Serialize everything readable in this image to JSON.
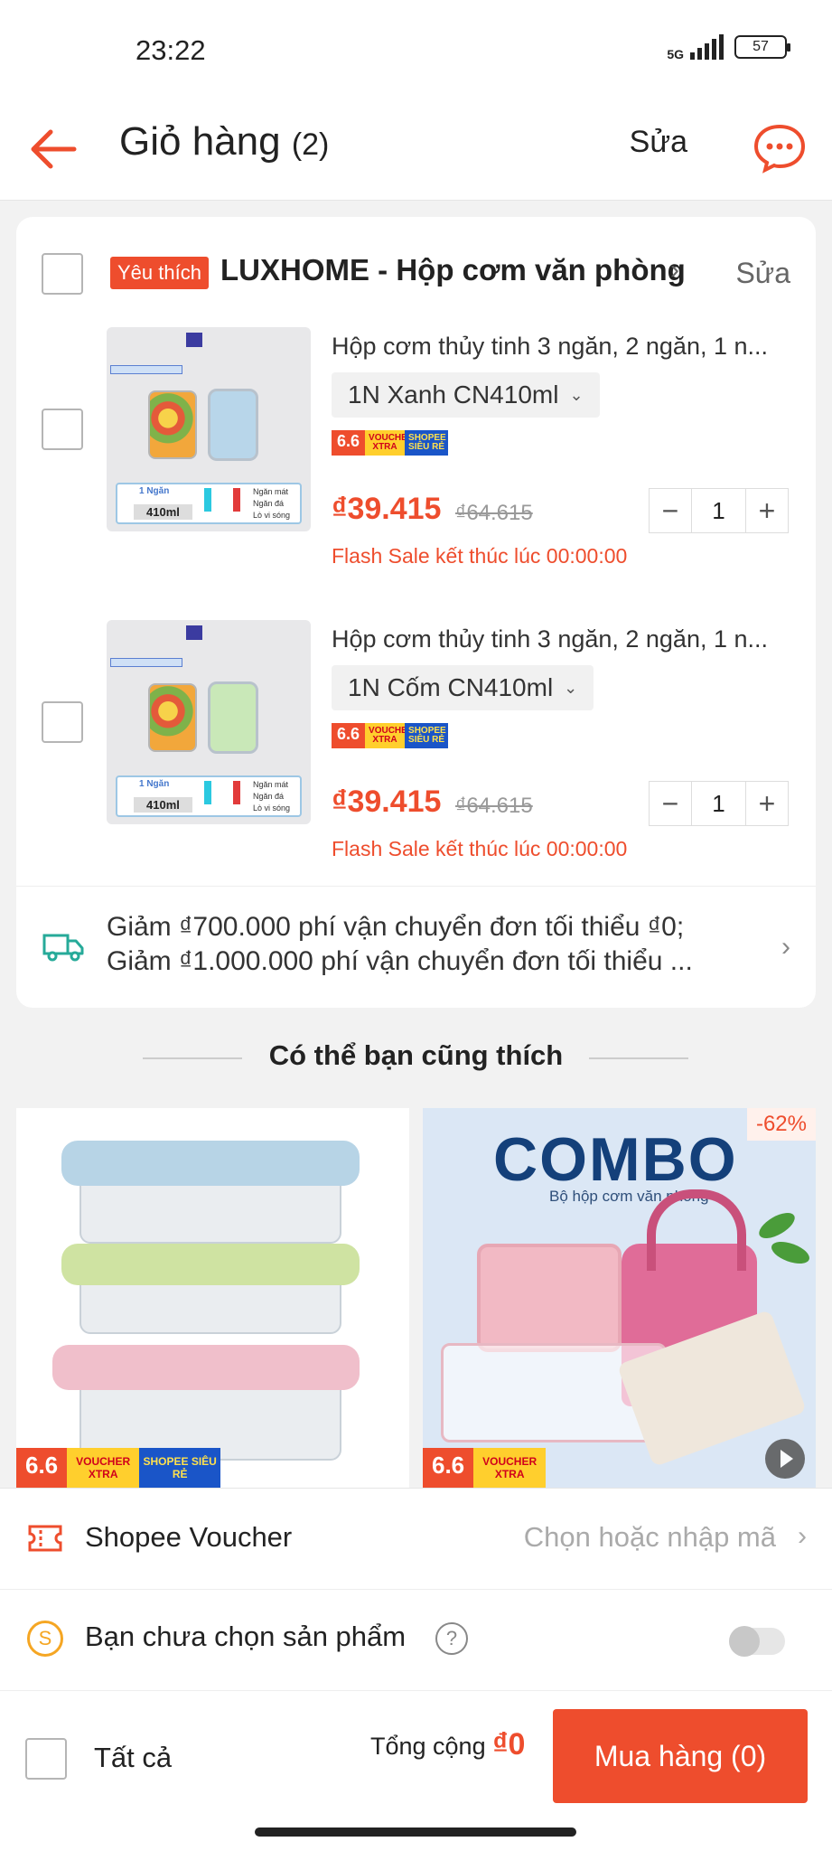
{
  "status_bar": {
    "time": "23:22",
    "network": "5G",
    "battery": "57"
  },
  "header": {
    "title": "Giỏ hàng",
    "count": "(2)",
    "edit": "Sửa"
  },
  "shop": {
    "badge": "Yêu thích",
    "name": "LUXHOME - Hộp cơm văn phòng",
    "edit": "Sửa"
  },
  "items": [
    {
      "title": "Hộp cơm thủy tinh 3 ngăn, 2 ngăn, 1 n...",
      "variant": "1N Xanh CN410ml",
      "price": "₫39.415",
      "old_price": "₫64.615",
      "quantity": "1",
      "flash_sale": "Flash Sale kết thúc lúc 00:00:00",
      "thumb_color": "#b8d6ea"
    },
    {
      "title": "Hộp cơm thủy tinh 3 ngăn, 2 ngăn, 1 n...",
      "variant": "1N Cốm CN410ml",
      "price": "₫39.415",
      "old_price": "₫64.615",
      "quantity": "1",
      "flash_sale": "Flash Sale kết thúc lúc 00:00:00",
      "thumb_color": "#c9e8b8"
    }
  ],
  "thumb": {
    "compartment": "1 Ngăn",
    "volume": "410ml",
    "temps": "-20°C 400°C",
    "features": [
      "Ngăn mát",
      "Ngăn đá",
      "Lò vi sóng"
    ]
  },
  "promo_tags": {
    "sale": "6.6",
    "voucher": "VOUCHER XTRA",
    "shopee": "SHOPEE SIÊU RẺ"
  },
  "shipping": {
    "line1": "Giảm ₫700.000 phí vận chuyển đơn tối thiểu ₫0;",
    "line2": "Giảm ₫1.000.000 phí vận chuyển đơn tối thiểu ..."
  },
  "recommendations": {
    "title": "Có thể bạn cũng thích",
    "cards": [
      {
        "discount": ""
      },
      {
        "discount": "-62%",
        "headline": "COMBO",
        "subtitle": "Bộ hộp cơm văn phòng"
      }
    ]
  },
  "bottom": {
    "voucher_label": "Shopee Voucher",
    "voucher_hint": "Chọn hoặc nhập mã",
    "coin_symbol": "S",
    "coin_label": "Bạn chưa chọn sản phẩm",
    "help": "?",
    "all_label": "Tất cả",
    "total_label": "Tổng cộng",
    "total_value": "₫0",
    "buy_label": "Mua hàng (0)"
  },
  "colors": {
    "accent": "#ee4d2d",
    "coin": "#f5a623"
  }
}
